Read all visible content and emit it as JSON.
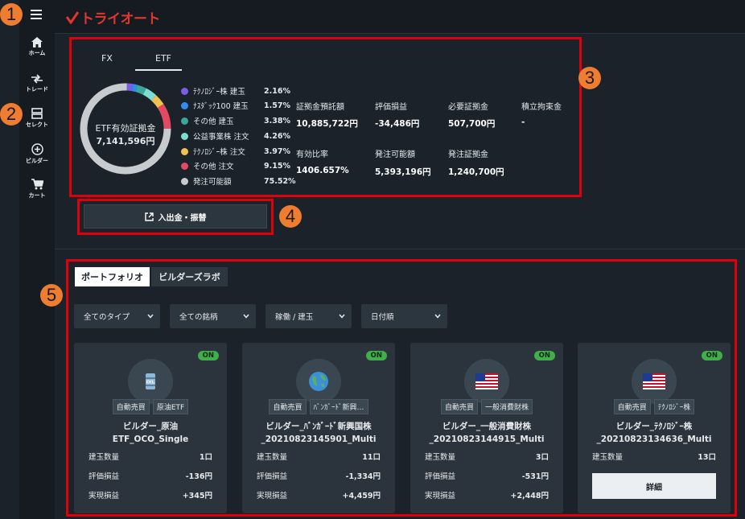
{
  "app": {
    "logo_text": "トライオート",
    "brand_color": "#e0362f"
  },
  "nav": [
    {
      "label": "ホーム",
      "icon": "home-icon"
    },
    {
      "label": "トレード",
      "icon": "trade-icon"
    },
    {
      "label": "セレクト",
      "icon": "select-icon"
    },
    {
      "label": "ビルダー",
      "icon": "builder-icon"
    },
    {
      "label": "カート",
      "icon": "cart-icon"
    }
  ],
  "callouts": [
    "1",
    "2",
    "3",
    "4",
    "5"
  ],
  "summary": {
    "tabs": [
      "FX",
      "ETF"
    ],
    "active_tab": "ETF",
    "donut_title": "ETF有効証拠金",
    "donut_value": "7,141,596円",
    "legend": [
      {
        "label": "ﾃｸﾉﾛｼﾞｰ株 建玉",
        "pct": "2.16%",
        "color": "#7b5ee8"
      },
      {
        "label": "ﾅｽﾀﾞｯｸ100 建玉",
        "pct": "1.57%",
        "color": "#2e8ff0"
      },
      {
        "label": "その他 建玉",
        "pct": "3.38%",
        "color": "#3aa79a"
      },
      {
        "label": "公益事業株 注文",
        "pct": "4.26%",
        "color": "#7fdcd0"
      },
      {
        "label": "ﾃｸﾉﾛｼﾞｰ株 注文",
        "pct": "3.97%",
        "color": "#f2c14e"
      },
      {
        "label": "その他 注文",
        "pct": "9.15%",
        "color": "#e24a62"
      },
      {
        "label": "発注可能額",
        "pct": "75.52%",
        "color": "#c8cbcd"
      }
    ],
    "stats": [
      {
        "label": "証拠金預託額",
        "value": "10,885,722円"
      },
      {
        "label": "評価損益",
        "value": "-34,486円"
      },
      {
        "label": "必要証拠金",
        "value": "507,700円"
      },
      {
        "label": "積立拘束金",
        "value": "-"
      },
      {
        "label": "有効比率",
        "value": "1406.657%"
      },
      {
        "label": "発注可能額",
        "value": "5,393,196円"
      },
      {
        "label": "発注証拠金",
        "value": "1,240,700円"
      }
    ],
    "transfer_label": "入出金・振替"
  },
  "portfolio": {
    "tabs": [
      "ポートフォリオ",
      "ビルダーズラボ"
    ],
    "filters": [
      "全てのタイプ",
      "全ての銘柄",
      "稼働 / 建玉",
      "日付順"
    ],
    "row_labels": [
      "建玉数量",
      "評価損益",
      "実現損益"
    ],
    "detail_label": "詳細",
    "cards": [
      {
        "status": "ON",
        "icon": "oil-barrel-icon",
        "tags": [
          "自動売買",
          "原油ETF"
        ],
        "name1": "ビルダー_原油",
        "name2": "ETF_OCO_Single",
        "values": [
          "1口",
          "-136円",
          "+345円"
        ]
      },
      {
        "status": "ON",
        "icon": "globe-icon",
        "tags": [
          "自動売買",
          "ﾊﾞﾝｶﾞｰﾄﾞ新興…"
        ],
        "name1": "ビルダー_ﾊﾞﾝｶﾞｰﾄﾞ新興国株",
        "name2": "_20210823145901_Multi",
        "values": [
          "11口",
          "-1,334円",
          "+4,459円"
        ]
      },
      {
        "status": "ON",
        "icon": "us-flag-icon",
        "tags": [
          "自動売買",
          "一般消費財株"
        ],
        "name1": "ビルダー_一般消費財株",
        "name2": "_20210823144915_Multi",
        "values": [
          "3口",
          "-531円",
          "+2,448円"
        ]
      },
      {
        "status": "ON",
        "icon": "us-flag-icon",
        "tags": [
          "自動売買",
          "ﾃｸﾉﾛｼﾞｰ株"
        ],
        "name1": "ビルダー_ﾃｸﾉﾛｼﾞｰ株",
        "name2": "_20210823134636_Multi",
        "values": [
          "13口",
          "",
          ""
        ]
      }
    ]
  }
}
